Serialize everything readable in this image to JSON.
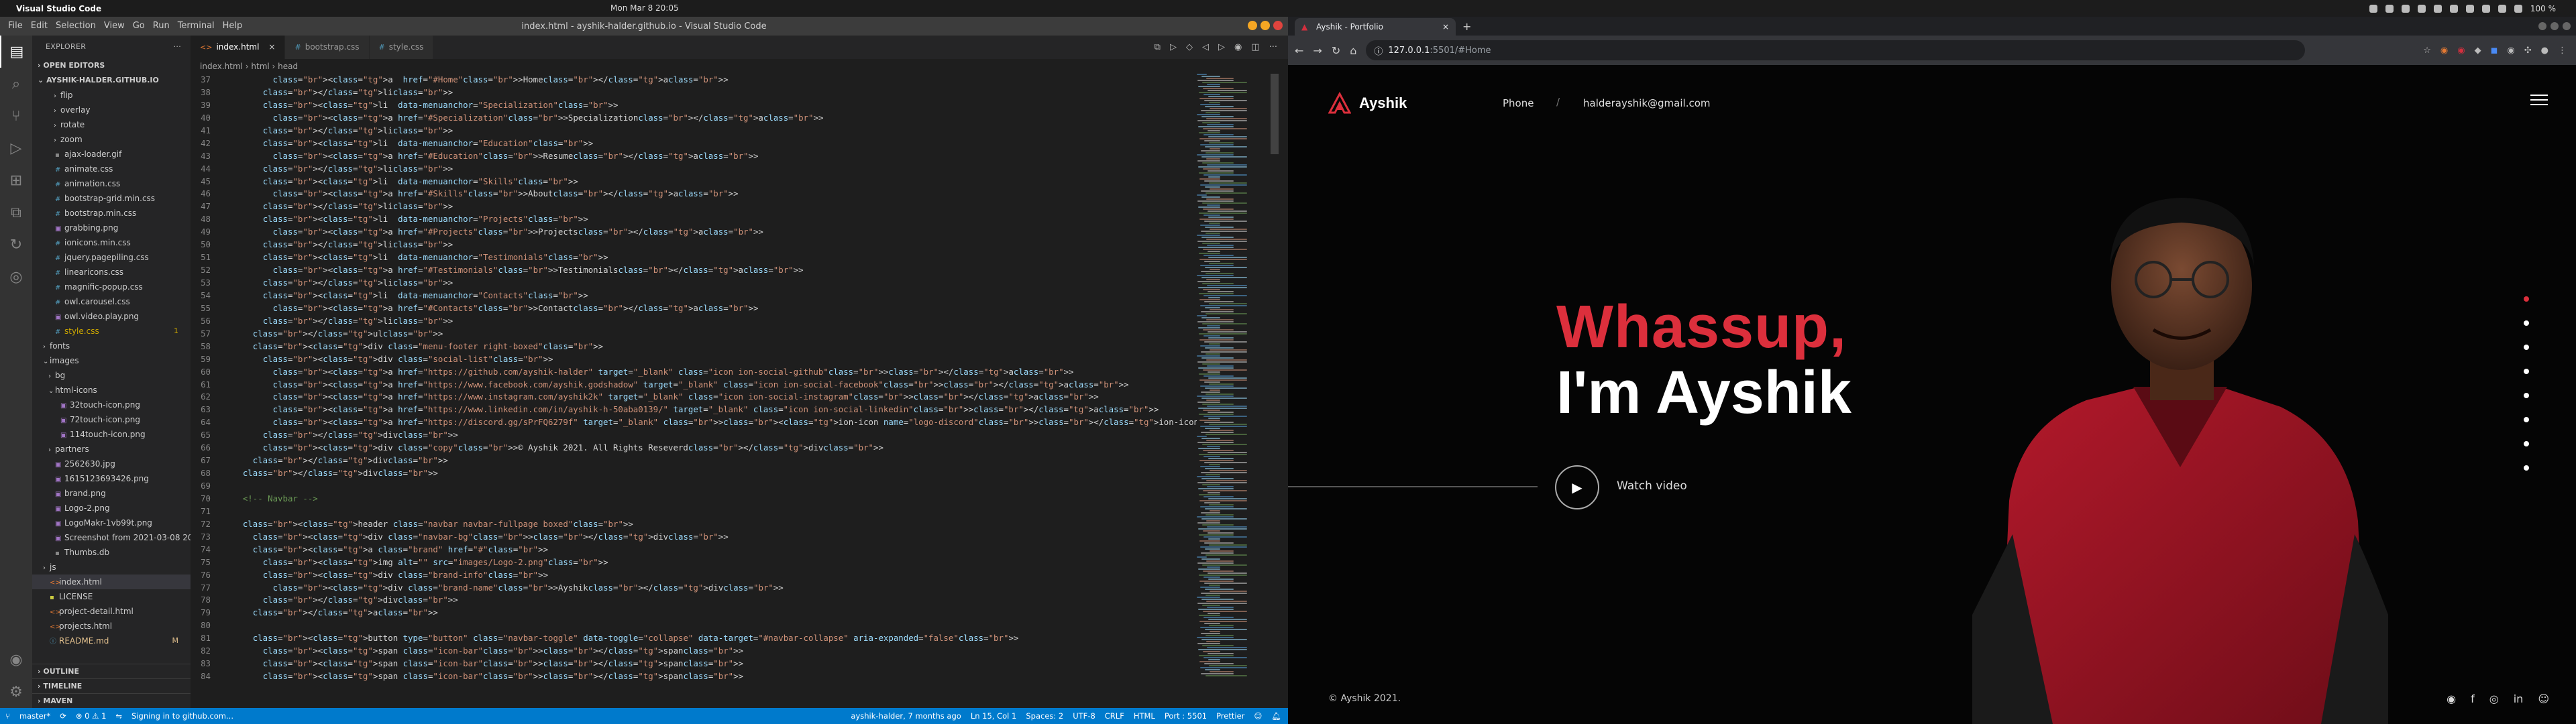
{
  "system": {
    "app_name": "Visual Studio Code",
    "clock": "Mon Mar 8  20:05",
    "battery": "100 %"
  },
  "vscode": {
    "menu": [
      "File",
      "Edit",
      "Selection",
      "View",
      "Go",
      "Run",
      "Terminal",
      "Help"
    ],
    "window_title": "index.html - ayshik-halder.github.io - Visual Studio Code",
    "explorer_title": "EXPLORER",
    "open_editors": "OPEN EDITORS",
    "root_folder": "AYSHIK-HALDER.GITHUB.IO",
    "tree": [
      {
        "label": "flip",
        "type": "folder",
        "indent": 3
      },
      {
        "label": "overlay",
        "type": "folder",
        "indent": 3
      },
      {
        "label": "rotate",
        "type": "folder",
        "indent": 3
      },
      {
        "label": "zoom",
        "type": "folder",
        "indent": 3
      },
      {
        "label": "ajax-loader.gif",
        "type": "file",
        "indent": 2
      },
      {
        "label": "animate.css",
        "type": "css",
        "indent": 2
      },
      {
        "label": "animation.css",
        "type": "css",
        "indent": 2
      },
      {
        "label": "bootstrap-grid.min.css",
        "type": "css",
        "indent": 2
      },
      {
        "label": "bootstrap.min.css",
        "type": "css",
        "indent": 2
      },
      {
        "label": "grabbing.png",
        "type": "img",
        "indent": 2
      },
      {
        "label": "ionicons.min.css",
        "type": "css",
        "indent": 2
      },
      {
        "label": "jquery.pagepiling.css",
        "type": "css",
        "indent": 2
      },
      {
        "label": "linearicons.css",
        "type": "css",
        "indent": 2
      },
      {
        "label": "magnific-popup.css",
        "type": "css",
        "indent": 2
      },
      {
        "label": "owl.carousel.css",
        "type": "css",
        "indent": 2
      },
      {
        "label": "owl.video.play.png",
        "type": "img",
        "indent": 2
      },
      {
        "label": "style.css",
        "type": "css-mod",
        "indent": 2,
        "badge": "1"
      },
      {
        "label": "fonts",
        "type": "folder",
        "indent": 1
      },
      {
        "label": "images",
        "type": "folder-open",
        "indent": 1
      },
      {
        "label": "bg",
        "type": "folder",
        "indent": 2
      },
      {
        "label": "html-icons",
        "type": "folder-open",
        "indent": 2
      },
      {
        "label": "32touch-icon.png",
        "type": "img",
        "indent": 3
      },
      {
        "label": "72touch-icon.png",
        "type": "img",
        "indent": 3
      },
      {
        "label": "114touch-icon.png",
        "type": "img",
        "indent": 3
      },
      {
        "label": "partners",
        "type": "folder",
        "indent": 2
      },
      {
        "label": "2562630.jpg",
        "type": "img",
        "indent": 2
      },
      {
        "label": "1615123693426.png",
        "type": "img",
        "indent": 2
      },
      {
        "label": "brand.png",
        "type": "img",
        "indent": 2
      },
      {
        "label": "Logo-2.png",
        "type": "img",
        "indent": 2
      },
      {
        "label": "LogoMakr-1vb99t.png",
        "type": "img",
        "indent": 2
      },
      {
        "label": "Screenshot from 2021-03-08 20...",
        "type": "img",
        "indent": 2
      },
      {
        "label": "Thumbs.db",
        "type": "file",
        "indent": 2
      },
      {
        "label": "js",
        "type": "folder",
        "indent": 1
      },
      {
        "label": "index.html",
        "type": "html",
        "indent": 1,
        "selected": true
      },
      {
        "label": "LICENSE",
        "type": "lic",
        "indent": 1
      },
      {
        "label": "project-detail.html",
        "type": "html",
        "indent": 1
      },
      {
        "label": "projects.html",
        "type": "html",
        "indent": 1
      },
      {
        "label": "README.md",
        "type": "md",
        "indent": 1,
        "badge": "M"
      }
    ],
    "bottom_sections": [
      "OUTLINE",
      "TIMELINE",
      "MAVEN"
    ],
    "tabs": [
      {
        "label": "index.html",
        "active": true
      },
      {
        "label": "bootstrap.css",
        "active": false
      },
      {
        "label": "style.css",
        "active": false
      }
    ],
    "breadcrumbs": "index.html  ›  html  ›  head",
    "status": {
      "branch": "master*",
      "sync": "⟳",
      "problems": "⊗ 0  ⚠ 1",
      "signing": "Signing in to github.com...",
      "blame": "ayshik-halder, 7 months ago",
      "position": "Ln 15, Col 1",
      "spaces": "Spaces: 2",
      "encoding": "UTF-8",
      "eol": "CRLF",
      "language": "HTML",
      "port": "Port : 5501",
      "prettier": "Prettier"
    }
  },
  "chrome": {
    "tab_title": "Ayshik - Portfolio",
    "url_host": "127.0.0.1",
    "url_path": ":5501/#Home"
  },
  "site": {
    "brand": "Ayshik",
    "phone": "Phone",
    "separator": "/",
    "email": "halderayshik@gmail.com",
    "hero_line1": "Whassup,",
    "hero_line2": "I'm Ayshik",
    "watch": "Watch video",
    "copyright": "© Ayshik 2021.",
    "accent": "#dc2f3c",
    "page_dots": 8,
    "active_dot": 1
  }
}
